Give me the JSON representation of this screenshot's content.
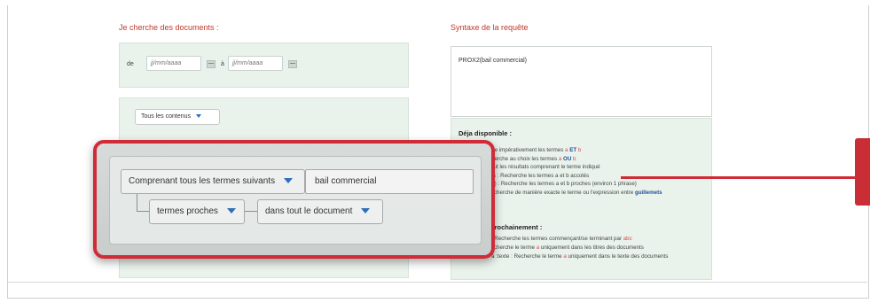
{
  "left": {
    "heading": "Je cherche des documents :",
    "date_from_label": "de",
    "date_from_placeholder": "jj/mm/aaaa",
    "date_to_label": "à",
    "date_to_placeholder": "jj/mm/aaaa",
    "content_filter": "Tous les contenus"
  },
  "overlay": {
    "terms_mode": "Comprenant tous les termes suivants",
    "terms_value": "bail commercial",
    "proximity_mode": "termes proches",
    "scope_mode": "dans tout le document"
  },
  "right": {
    "heading": "Syntaxe de la requête",
    "query": "PROX2(bail commercial)",
    "available_title": "Déja disponible :",
    "available_lines": [
      {
        "t1": "rche impérativement les termes ",
        "r": "a",
        "b": "ET",
        "r2": "b"
      },
      {
        "t1": "rcherche au choix les termes ",
        "r": "a",
        "b": "OU",
        "r2": "b"
      },
      {
        "t1": "xclut les résultats comprenant le terme indiqué"
      },
      {
        "t1": "ous : Recherche les termes a et b accolés"
      },
      {
        "t1": "a b) : Recherche les termes a et b proches (environ 1 phrase)"
      },
      {
        "t1": "Recherche de manière exacte le terme ou l'expression entre ",
        "b": "guillemets"
      }
    ],
    "soon_title": "prochainement :",
    "soon_lines": [
      {
        "t1": "c : Recherche les termes commençant/se terminant par ",
        "r": "abc"
      },
      {
        "t1": "Recherche le terme ",
        "r": "a",
        "t2": " uniquement dans les titres des documents"
      },
      {
        "t0": "« a :texte : ",
        "t1": "Recherche le terme ",
        "r": "a",
        "t2": " uniquement dans le texte des documents"
      }
    ]
  },
  "colors": {
    "accent_red": "#cf2c37",
    "heading_red": "#c0392b",
    "panel_green": "#eaf2ec",
    "link_blue": "#2d6fb8"
  },
  "icons": [
    "calendar-icon",
    "dropdown-arrow-icon"
  ]
}
